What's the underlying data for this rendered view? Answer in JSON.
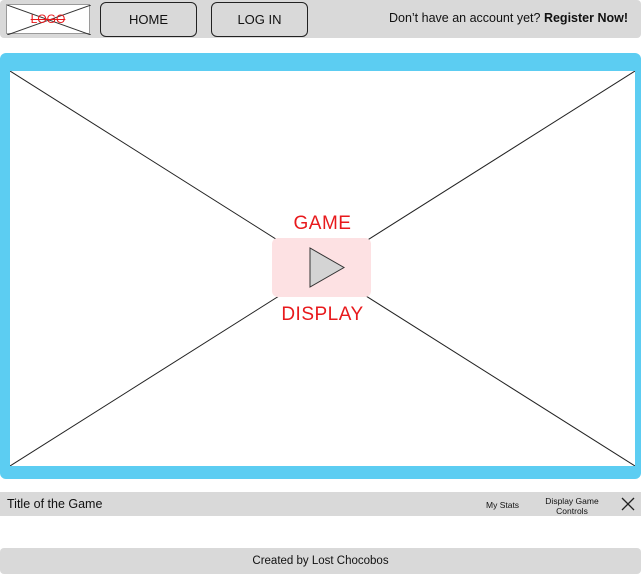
{
  "header": {
    "logo_text": "LOGO",
    "nav": {
      "home_label": "HOME",
      "login_label": "LOG IN"
    },
    "register_prompt": "Don’t have an account yet?",
    "register_link": "Register Now!"
  },
  "game": {
    "label_top": "GAME",
    "label_bottom": "DISPLAY",
    "play_icon": "play-icon"
  },
  "info_bar": {
    "title": "Title of the Game",
    "my_stats_label": "My Stats",
    "display_controls_label": "Display Game Controls",
    "close_icon": "close-icon"
  },
  "footer": {
    "credit": "Created by Lost Chocobos"
  },
  "colors": {
    "bar_gray": "#d9d9d9",
    "frame_blue": "#5ccdf2",
    "accent_red": "#e8191c",
    "play_bg": "#fde1e3"
  }
}
